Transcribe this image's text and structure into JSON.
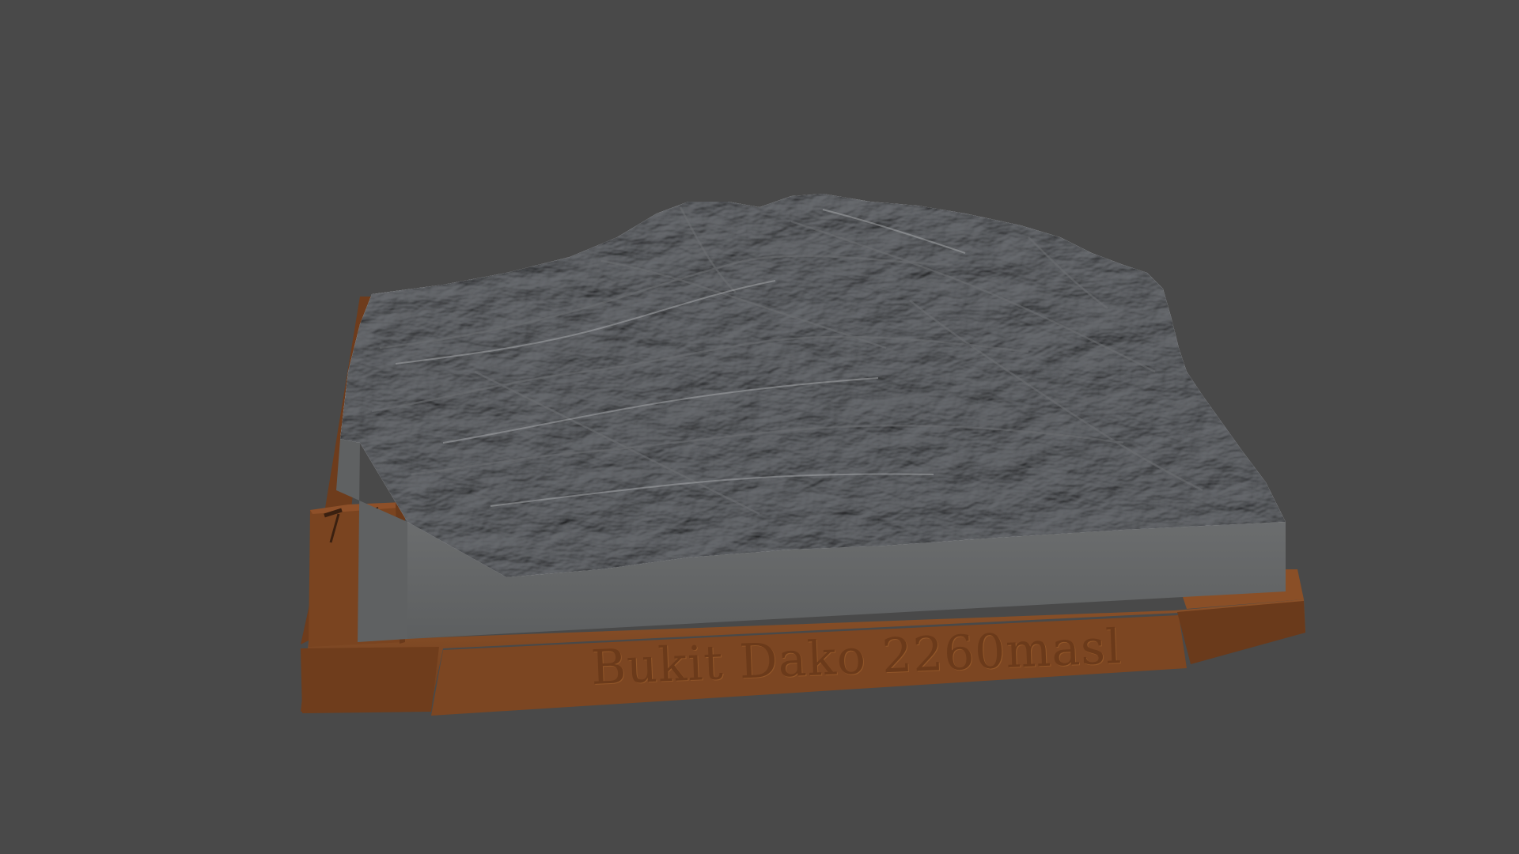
{
  "viewport": {
    "background_color": "#494949"
  },
  "model": {
    "base_color": "#7a4522",
    "base_dark_color": "#5e3418",
    "terrain_color": "#8e9093",
    "terrain_side_color": "#636566",
    "engraving_text": "Bukit Dako 2260masl",
    "marker_icons": [
      "hammer-icon",
      "pickaxe-icon"
    ]
  }
}
